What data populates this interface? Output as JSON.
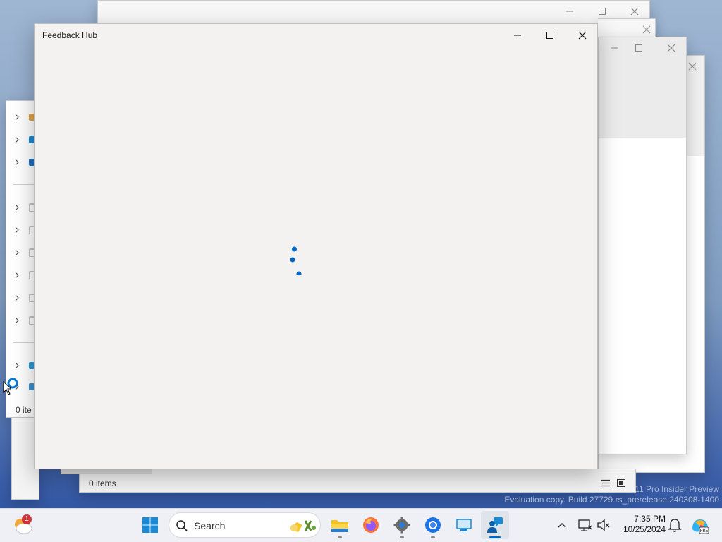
{
  "desktop": {
    "watermark_line1": "11 Pro Insider Preview",
    "watermark_line2": "Evaluation copy. Build 27729.rs_prerelease.240308-1400"
  },
  "background_explorer": {
    "nav_items": [
      {
        "icon": "home-icon"
      },
      {
        "icon": "gallery-icon"
      },
      {
        "icon": "onedrive-icon"
      },
      {
        "icon": "folder-icon"
      },
      {
        "icon": "folder-icon"
      },
      {
        "icon": "folder-icon"
      },
      {
        "icon": "folder-icon"
      },
      {
        "icon": "folder-icon"
      },
      {
        "icon": "folder-icon"
      },
      {
        "icon": "this-pc-icon"
      },
      {
        "icon": "network-icon"
      }
    ],
    "status_left": "0 ite",
    "status_items": "0 items"
  },
  "feedback_hub": {
    "title": "Feedback Hub",
    "loading": "loading-spinner",
    "accent": "#0067c0"
  },
  "taskbar": {
    "weather_badge": "1",
    "search_placeholder": "Search",
    "apps": [
      {
        "name": "start-button"
      },
      {
        "name": "file-explorer"
      },
      {
        "name": "firefox"
      },
      {
        "name": "settings"
      },
      {
        "name": "chrome"
      },
      {
        "name": "remote-desktop"
      },
      {
        "name": "feedback-hub"
      }
    ],
    "clock_time": "7:35 PM",
    "clock_date": "10/25/2024"
  }
}
